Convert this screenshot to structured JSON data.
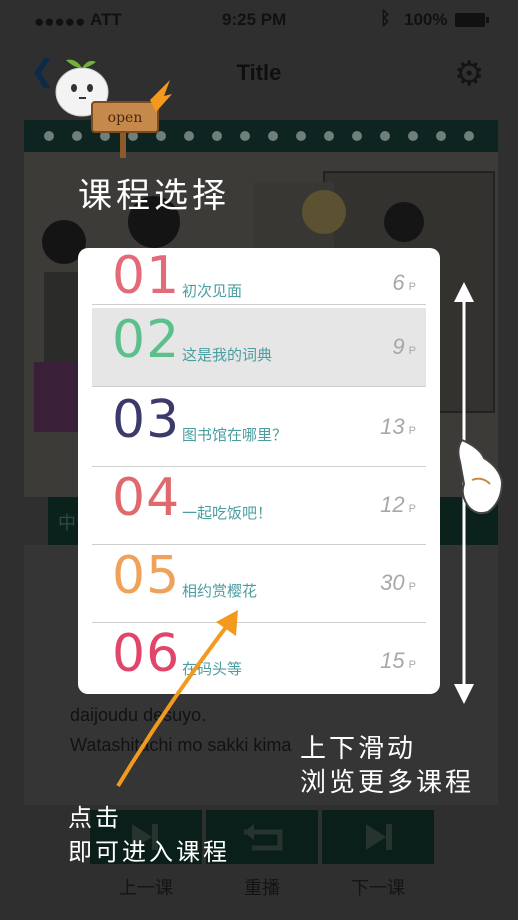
{
  "status_bar": {
    "carrier": "ATT",
    "time": "9:25 PM",
    "battery": "100%"
  },
  "nav": {
    "title": "Title"
  },
  "mascot": {
    "sign_text": "open"
  },
  "overlay": {
    "heading": "课程选择",
    "scroll_hint_line1": "上下滑动",
    "scroll_hint_line2": "浏览更多课程",
    "tap_hint_line1": "点击",
    "tap_hint_line2": "即可进入课程"
  },
  "lessons": [
    {
      "number": "01",
      "title": "初次见面",
      "pages": "6",
      "page_unit": "P",
      "color": "#e36a78"
    },
    {
      "number": "02",
      "title": "这是我的词典",
      "pages": "9",
      "page_unit": "P",
      "color": "#5cc08d"
    },
    {
      "number": "03",
      "title": "图书馆在哪里？",
      "pages": "13",
      "page_unit": "P",
      "color": "#3b3a6b"
    },
    {
      "number": "04",
      "title": "一起吃饭吧！",
      "pages": "12",
      "page_unit": "P",
      "color": "#e0696c"
    },
    {
      "number": "05",
      "title": "相约赏樱花",
      "pages": "30",
      "page_unit": "P",
      "color": "#f1a25a"
    },
    {
      "number": "06",
      "title": "在码头等",
      "pages": "15",
      "page_unit": "P",
      "color": "#e2456a"
    }
  ],
  "selected_lesson": "02",
  "background_text": {
    "line1": "daijoudu desuyo.",
    "line2": "Watashitachi mo sakki kima"
  },
  "controls": {
    "prev": "上一课",
    "replay": "重播",
    "next": "下一课"
  },
  "colors": {
    "accent_teal": "#4b9ea0",
    "annotation_arrow": "#f39a1e"
  }
}
